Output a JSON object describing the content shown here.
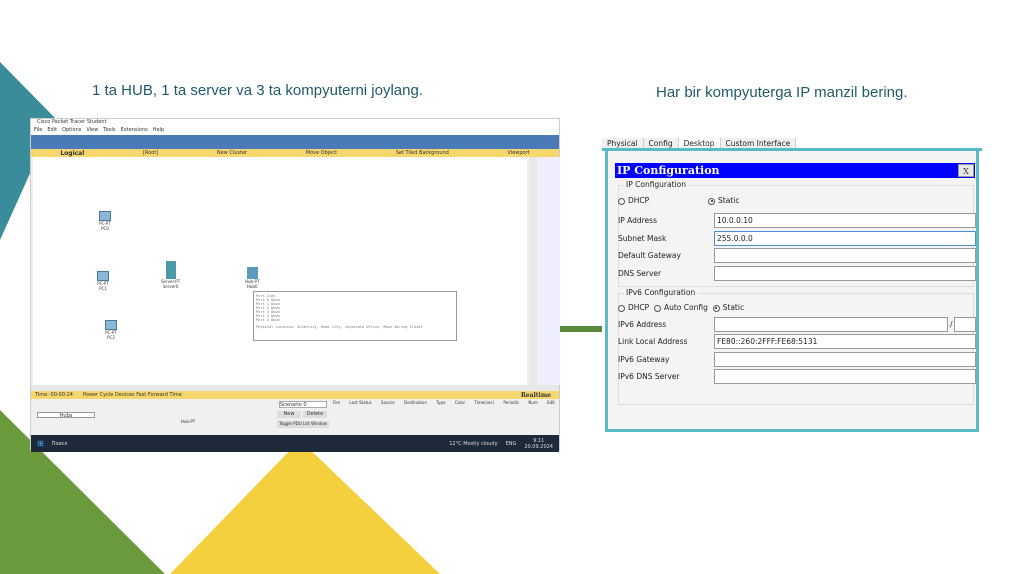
{
  "slide": {
    "left_caption": "1 ta HUB, 1 ta server va 3 ta kompyuterni joylang.",
    "right_caption": "Har bir kompyuterga IP manzil bering."
  },
  "colors": {
    "teal": "#3a8c9a",
    "green": "#6a9a3c",
    "yellow": "#f5d03e",
    "dialog_title": "#0000ff"
  },
  "packet_tracer": {
    "title": "Cisco Packet Tracer Student",
    "menu": [
      "File",
      "Edit",
      "Options",
      "View",
      "Tools",
      "Extensions",
      "Help"
    ],
    "bar": [
      "Logical",
      "[Root]",
      "New Cluster",
      "Move Object",
      "Set Tiled Background",
      "Viewport"
    ],
    "devices": [
      {
        "model": "PC-PT",
        "name": "PC0"
      },
      {
        "model": "PC-PT",
        "name": "PC1"
      },
      {
        "model": "PC-PT",
        "name": "PC2"
      },
      {
        "model": "Server-PT",
        "name": "Server0"
      },
      {
        "model": "Hub-PT",
        "name": "Hub0"
      }
    ],
    "tooltip": {
      "header": [
        "Port",
        "Link"
      ],
      "ports": [
        [
          "Port 0",
          "Down"
        ],
        [
          "Port 1",
          "Down"
        ],
        [
          "Port 2",
          "Down"
        ],
        [
          "Port 3",
          "Down"
        ],
        [
          "Port 4",
          "Down"
        ],
        [
          "Port 5",
          "Down"
        ]
      ],
      "location": "Physical Location: Intercity, Home City, Corporate Office, Main Wiring Closet"
    },
    "time": "Time: 00:00:24",
    "time_controls": "Power Cycle Devices  Fast Forward Time",
    "mode": "Realtime",
    "category": "Hubs",
    "sub_devices": [
      "Generic",
      "Generic",
      "Generic"
    ],
    "selected_device": "Hub-PT",
    "scenario": "Scenario 0",
    "new": "New",
    "delete": "Delete",
    "toggle_pdu": "Toggle PDU List Window",
    "pdu_columns": [
      "Fire",
      "Last Status",
      "Source",
      "Destination",
      "Type",
      "Color",
      "Time(sec)",
      "Periodic",
      "Num",
      "Edit"
    ],
    "taskbar": {
      "search": "Поиск",
      "weather": "12°C  Mostly cloudy",
      "lang": "ENG",
      "time": "9:11",
      "date": "20.09.2024"
    }
  },
  "ip_config": {
    "tabs": [
      "Physical",
      "Config",
      "Desktop",
      "Custom Interface"
    ],
    "active_tab": "Desktop",
    "title": "IP Configuration",
    "close": "X",
    "ipv4_group": "IP Configuration",
    "dhcp": "DHCP",
    "static": "Static",
    "ipv4_mode": "Static",
    "fields": [
      {
        "label": "IP Address",
        "value": "10.0.0.10"
      },
      {
        "label": "Subnet Mask",
        "value": "255.0.0.0"
      },
      {
        "label": "Default Gateway",
        "value": ""
      },
      {
        "label": "DNS Server",
        "value": ""
      }
    ],
    "ipv6_group": "IPv6 Configuration",
    "auto_config": "Auto Config",
    "ipv6_mode": "Static",
    "ipv6_address_label": "IPv6 Address",
    "ipv6_address": "",
    "prefix_sep": "/",
    "prefix": "",
    "ipv6_fields": [
      {
        "label": "Link Local Address",
        "value": "FE80::260:2FFF:FE68:5131"
      },
      {
        "label": "IPv6 Gateway",
        "value": ""
      },
      {
        "label": "IPv6 DNS Server",
        "value": ""
      }
    ]
  }
}
